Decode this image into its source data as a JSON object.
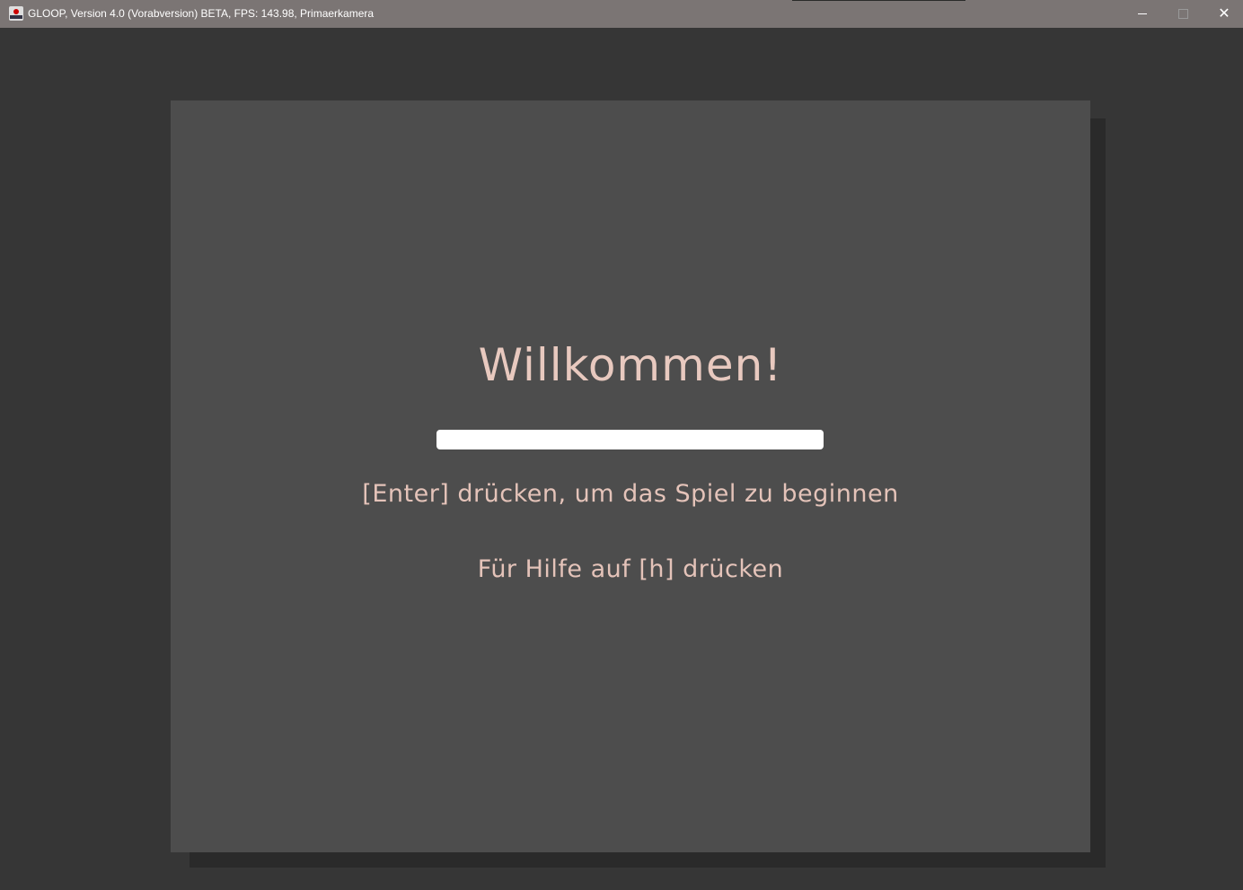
{
  "window": {
    "title": "GLOOP, Version 4.0 (Vorabversion) BETA, FPS: 143.98, Primaerkamera",
    "minimize": "–",
    "maximize": "□",
    "close": "✕"
  },
  "screen": {
    "headline": "Willkommen!",
    "start_hint": "[Enter] drücken, um das Spiel zu beginnen",
    "help_hint": "Für Hilfe auf [h] drücken",
    "text_color": "#e8c9bf",
    "panel_color": "#4d4d4d",
    "background_color": "#363636"
  }
}
